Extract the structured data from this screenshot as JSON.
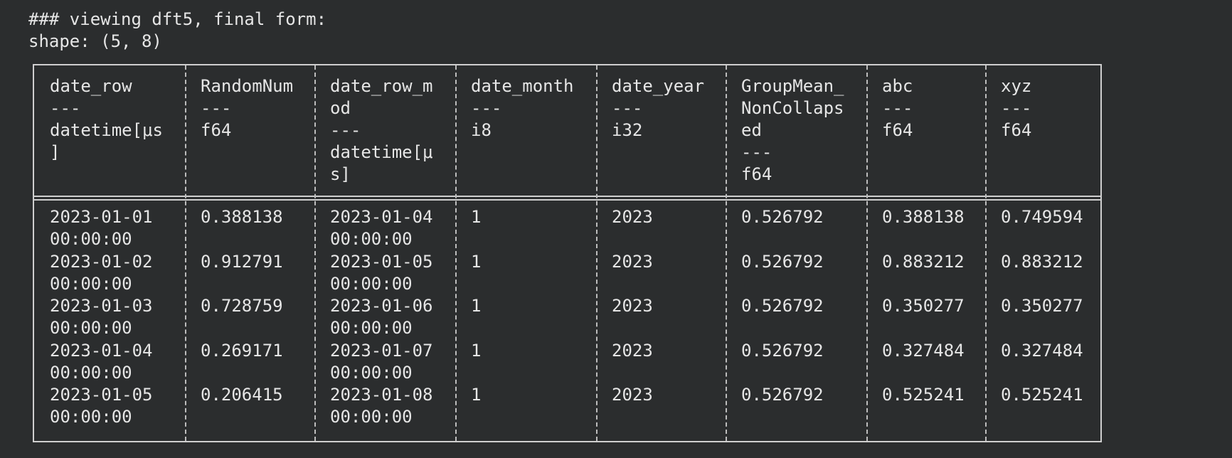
{
  "caption": {
    "line1": "### viewing dft5, final form:",
    "line2": "shape: (5, 8)"
  },
  "table": {
    "columns": [
      {
        "name_lines": [
          "date_row"
        ],
        "sep": "---",
        "dtype_lines": [
          "datetime[μs",
          "]"
        ]
      },
      {
        "name_lines": [
          "RandomNum"
        ],
        "sep": "---",
        "dtype_lines": [
          "f64"
        ]
      },
      {
        "name_lines": [
          "date_row_m",
          "od"
        ],
        "sep": "---",
        "dtype_lines": [
          "datetime[μ",
          "s]"
        ]
      },
      {
        "name_lines": [
          "date_month"
        ],
        "sep": "---",
        "dtype_lines": [
          "i8"
        ]
      },
      {
        "name_lines": [
          "date_year"
        ],
        "sep": "---",
        "dtype_lines": [
          "i32"
        ]
      },
      {
        "name_lines": [
          "GroupMean_",
          "NonCollaps",
          "ed"
        ],
        "sep": "---",
        "dtype_lines": [
          "f64"
        ]
      },
      {
        "name_lines": [
          "abc"
        ],
        "sep": "---",
        "dtype_lines": [
          "f64"
        ]
      },
      {
        "name_lines": [
          "xyz"
        ],
        "sep": "---",
        "dtype_lines": [
          "f64"
        ]
      }
    ],
    "rows": [
      [
        [
          "2023-01-01",
          "00:00:00"
        ],
        [
          "0.388138"
        ],
        [
          "2023-01-04",
          "00:00:00"
        ],
        [
          "1"
        ],
        [
          "2023"
        ],
        [
          "0.526792"
        ],
        [
          "0.388138"
        ],
        [
          "0.749594"
        ]
      ],
      [
        [
          "2023-01-02",
          "00:00:00"
        ],
        [
          "0.912791"
        ],
        [
          "2023-01-05",
          "00:00:00"
        ],
        [
          "1"
        ],
        [
          "2023"
        ],
        [
          "0.526792"
        ],
        [
          "0.883212"
        ],
        [
          "0.883212"
        ]
      ],
      [
        [
          "2023-01-03",
          "00:00:00"
        ],
        [
          "0.728759"
        ],
        [
          "2023-01-06",
          "00:00:00"
        ],
        [
          "1"
        ],
        [
          "2023"
        ],
        [
          "0.526792"
        ],
        [
          "0.350277"
        ],
        [
          "0.350277"
        ]
      ],
      [
        [
          "2023-01-04",
          "00:00:00"
        ],
        [
          "0.269171"
        ],
        [
          "2023-01-07",
          "00:00:00"
        ],
        [
          "1"
        ],
        [
          "2023"
        ],
        [
          "0.526792"
        ],
        [
          "0.327484"
        ],
        [
          "0.327484"
        ]
      ],
      [
        [
          "2023-01-05",
          "00:00:00"
        ],
        [
          "0.206415"
        ],
        [
          "2023-01-08",
          "00:00:00"
        ],
        [
          "1"
        ],
        [
          "2023"
        ],
        [
          "0.526792"
        ],
        [
          "0.525241"
        ],
        [
          "0.525241"
        ]
      ]
    ]
  },
  "colors": {
    "background": "#2b2d2e",
    "text": "#e6e6e6",
    "border": "#cfcfcf"
  }
}
